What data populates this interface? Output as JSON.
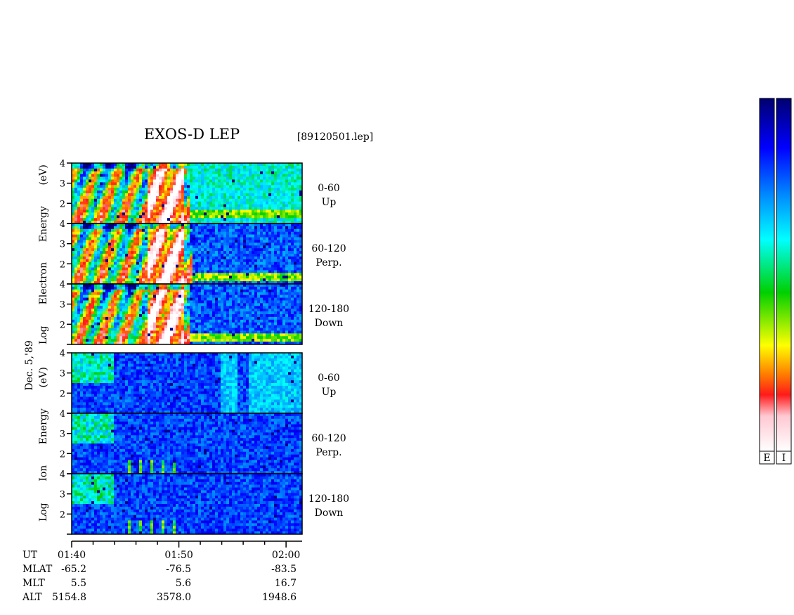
{
  "header": {
    "title": "EXOS-D LEP",
    "file": "[89120501.lep]"
  },
  "side_label": "Dec. 5,'89",
  "colors": {
    "colormap": [
      "#ffffff",
      "#ffc8d2",
      "#ff1a1a",
      "#ff8000",
      "#ffff00",
      "#00d000",
      "#00ffff",
      "#0090ff",
      "#0000ff",
      "#000070"
    ]
  },
  "colorbars": [
    {
      "label": "E"
    },
    {
      "label": "I"
    }
  ],
  "chart_data": {
    "type": "heatmap",
    "title": "EXOS-D LEP",
    "groups": [
      {
        "species": "Electron",
        "ylabel_parts": [
          "Log",
          "Electron",
          "Energy",
          "(eV)"
        ],
        "panels": [
          {
            "range": "0-60",
            "direction": "Up",
            "ylim": [
              1,
              4
            ],
            "yticks": [
              "2",
              "3",
              "4"
            ],
            "hot_extent_min": 11.0,
            "band_level": 1.5
          },
          {
            "range": "60-120",
            "direction": "Perp.",
            "ylim": [
              1,
              4
            ],
            "yticks": [
              "2",
              "3",
              "4"
            ],
            "hot_extent_min": 11.2,
            "band_level": 1.4
          },
          {
            "range": "120-180",
            "direction": "Down",
            "ylim": [
              1,
              4
            ],
            "yticks": [
              "2",
              "3",
              "4"
            ],
            "hot_extent_min": 11.0,
            "band_level": 1.3
          }
        ]
      },
      {
        "species": "Ion",
        "ylabel_parts": [
          "Log",
          "Ion",
          "Energy",
          "(eV)"
        ],
        "panels": [
          {
            "range": "0-60",
            "direction": "Up",
            "ylim": [
              1,
              4
            ],
            "yticks": [
              "2",
              "3",
              "4"
            ]
          },
          {
            "range": "60-120",
            "direction": "Perp.",
            "ylim": [
              1,
              4
            ],
            "yticks": [
              "2",
              "3",
              "4"
            ]
          },
          {
            "range": "120-180",
            "direction": "Down",
            "ylim": [
              1,
              4
            ],
            "yticks": [
              "2",
              "3",
              "4"
            ]
          }
        ]
      }
    ],
    "time_axis": {
      "start_min": 0,
      "end_min": 21.5,
      "major_ticks": [
        {
          "label": "01:40",
          "minute": 0
        },
        {
          "label": "01:50",
          "minute": 10
        },
        {
          "label": "02:00",
          "minute": 20
        }
      ],
      "minor_step_min": 2
    },
    "orbit": {
      "rows": [
        {
          "name": "UT",
          "values": [
            "",
            "",
            ""
          ]
        },
        {
          "name": "MLAT",
          "values": [
            "-65.2",
            "-76.5",
            "-83.5"
          ]
        },
        {
          "name": "MLT",
          "values": [
            "5.5",
            "5.6",
            "16.7"
          ]
        },
        {
          "name": "ALT",
          "values": [
            "5154.8",
            "3578.0",
            "1948.6"
          ]
        }
      ]
    }
  }
}
